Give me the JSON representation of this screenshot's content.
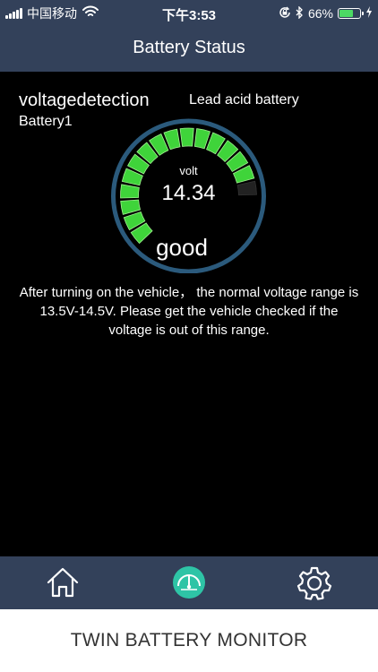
{
  "status_bar": {
    "carrier": "中国移动",
    "time": "下午3:53",
    "battery_percent": "66%",
    "battery_level": 0.66,
    "icons": [
      "signal-icon",
      "wifi-icon",
      "orientation-lock-icon",
      "bluetooth-icon",
      "battery-icon",
      "charging-icon"
    ]
  },
  "nav": {
    "title": "Battery Status"
  },
  "detection": {
    "title": "voltagedetection",
    "battery_name": "Battery1",
    "battery_type": "Lead acid battery"
  },
  "gauge": {
    "unit": "volt",
    "value": "14.34",
    "status": "good",
    "segments_total": 16,
    "segments_lit": 15,
    "colors": {
      "ring": "#2b5a7c",
      "lit": "#3fd43a",
      "lit_edge": "#9ff08f",
      "unlit": "#222222"
    }
  },
  "note": {
    "text": "After turning on the vehicle， the normal voltage range is 13.5V-14.5V. Please get the vehicle checked if the voltage is out of this range."
  },
  "tabbar": {
    "tabs": [
      {
        "icon": "home-icon",
        "active": false
      },
      {
        "icon": "gauge-icon",
        "active": true
      },
      {
        "icon": "gear-icon",
        "active": false
      }
    ],
    "active_color": "#2ec4a6"
  },
  "footer": {
    "text": "TWIN BATTERY MONITOR"
  }
}
